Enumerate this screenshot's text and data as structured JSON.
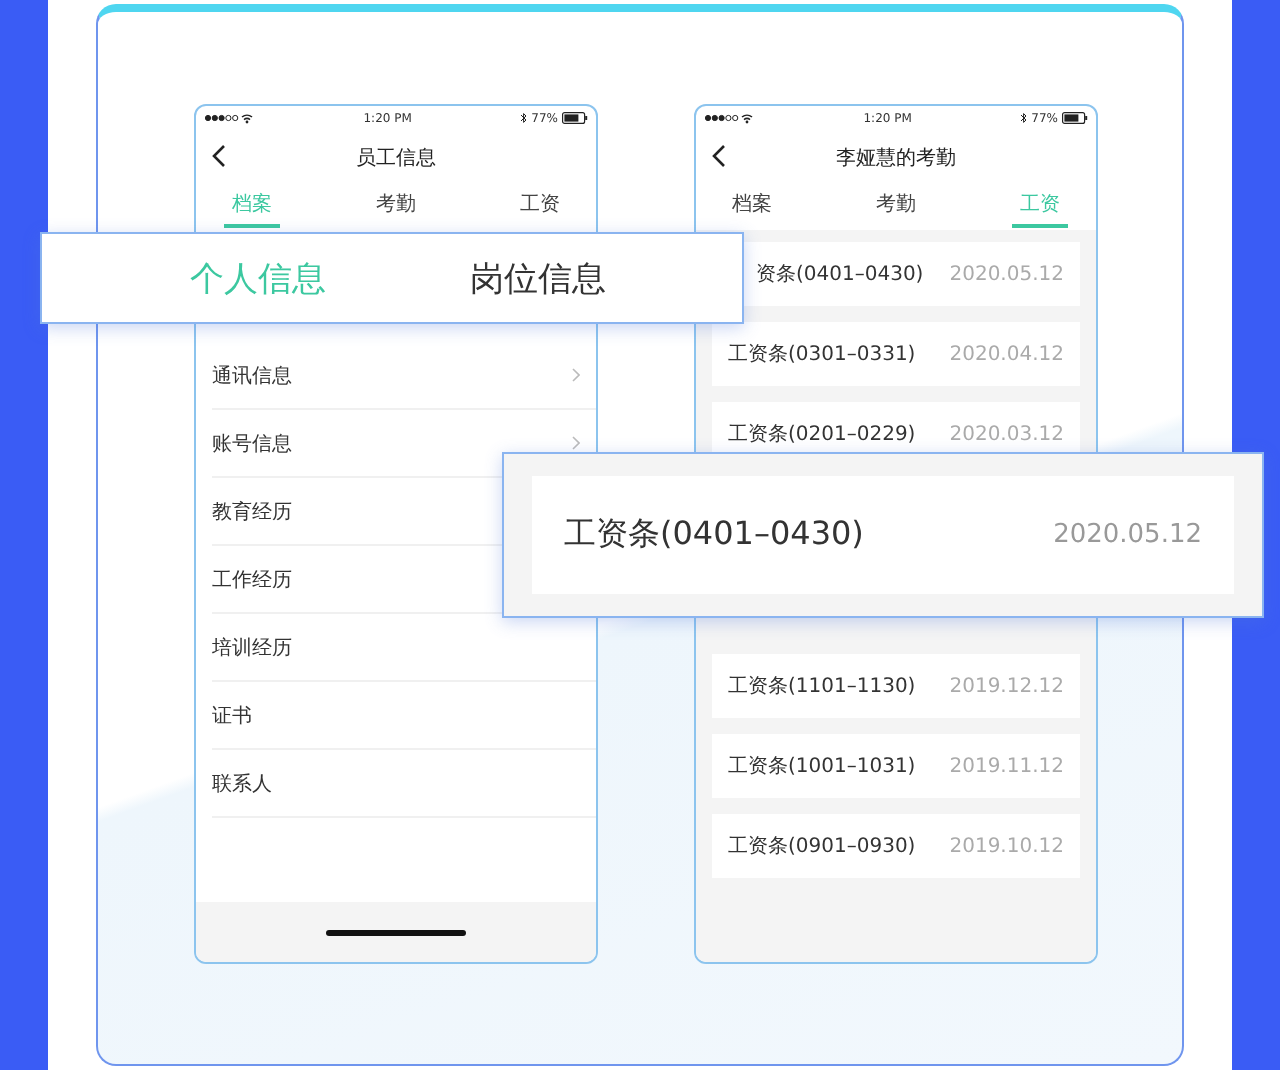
{
  "phones": [
    {
      "status": {
        "time": "1:20 PM",
        "battery": "77%"
      },
      "title": "员工信息",
      "tabs": [
        {
          "label": "档案",
          "selected": true
        },
        {
          "label": "考勤",
          "selected": false
        },
        {
          "label": "工资",
          "selected": false
        }
      ],
      "rows": [
        {
          "label": "通讯信息",
          "chevron": true
        },
        {
          "label": "账号信息",
          "chevron": true
        },
        {
          "label": "教育经历"
        },
        {
          "label": "工作经历"
        },
        {
          "label": "培训经历",
          "chevron": false
        },
        {
          "label": "证书",
          "chevron": false
        },
        {
          "label": "联系人",
          "chevron": false
        }
      ]
    },
    {
      "status": {
        "time": "1:20 PM",
        "battery": "77%"
      },
      "title": "李娅慧的考勤",
      "tabs": [
        {
          "label": "档案",
          "selected": false
        },
        {
          "label": "考勤",
          "selected": false
        },
        {
          "label": "工资",
          "selected": true
        }
      ],
      "payslips": [
        {
          "name": "资条(0401–0430)",
          "date": "2020.05.12"
        },
        {
          "name": "工资条(0301–0331)",
          "date": "2020.04.12"
        },
        {
          "name": "工资条(0201–0229)",
          "date": "2020.03.12"
        },
        {
          "name": "工资条(1101–1130)",
          "date": "2019.12.12"
        },
        {
          "name": "工资条(1001–1031)",
          "date": "2019.11.12"
        },
        {
          "name": "工资条(0901–0930)",
          "date": "2019.10.12"
        }
      ]
    }
  ],
  "tab_callout": {
    "tabs": [
      {
        "label": "个人信息",
        "selected": true
      },
      {
        "label": "岗位信息",
        "selected": false
      }
    ]
  },
  "payslip_callout": {
    "name": "工资条(0401–0430)",
    "date": "2020.05.12"
  }
}
